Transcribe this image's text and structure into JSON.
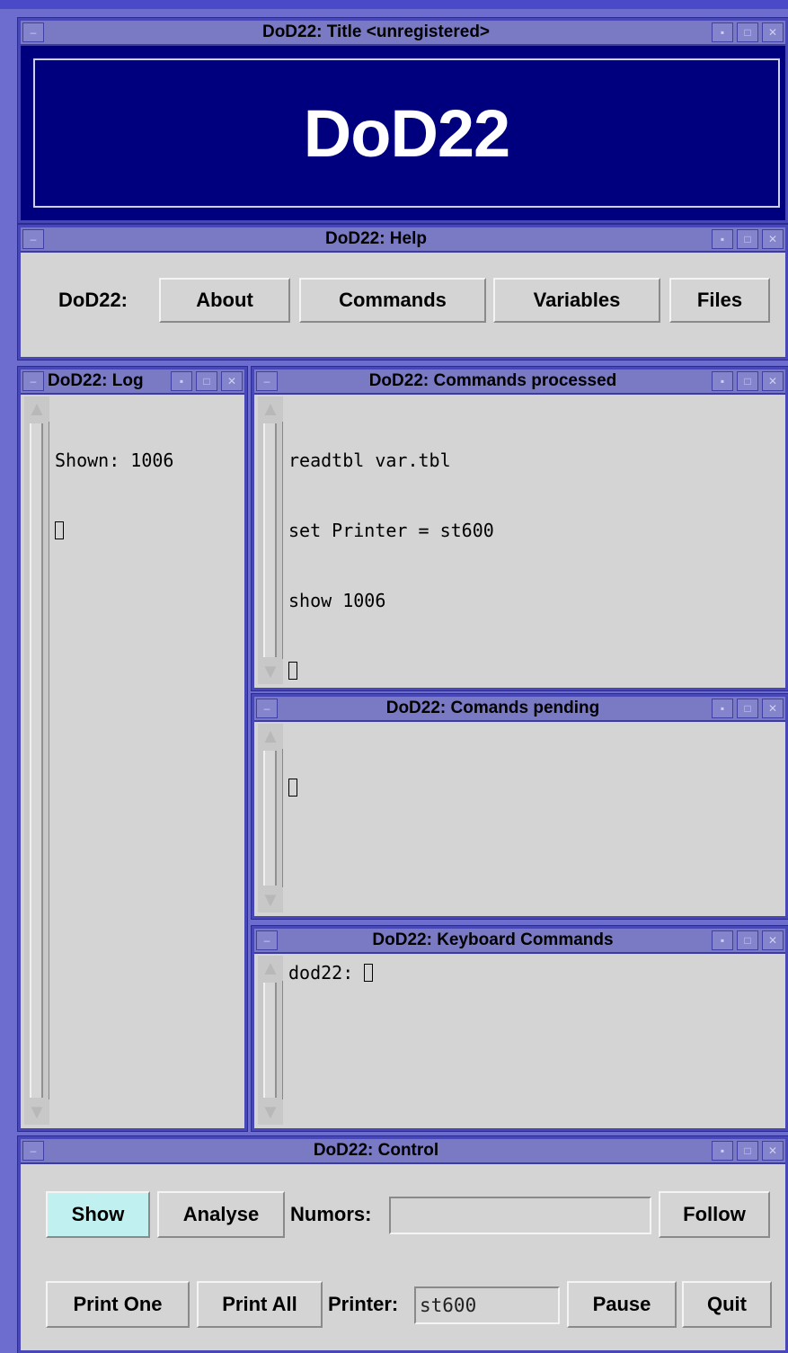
{
  "title_window": {
    "title": "DoD22: Title <unregistered>",
    "banner": "DoD22"
  },
  "help_window": {
    "title": "DoD22: Help",
    "label": "DoD22:",
    "buttons": {
      "about": "About",
      "commands": "Commands",
      "variables": "Variables",
      "files": "Files"
    }
  },
  "log_window": {
    "title": "DoD22: Log",
    "lines": [
      "Shown: 1006"
    ]
  },
  "processed_window": {
    "title": "DoD22: Commands processed",
    "lines": [
      "readtbl var.tbl",
      "set Printer = st600",
      "show 1006"
    ]
  },
  "pending_window": {
    "title": "DoD22: Comands pending"
  },
  "keyboard_window": {
    "title": "DoD22: Keyboard Commands",
    "prompt": "dod22: "
  },
  "control_window": {
    "title": "DoD22: Control",
    "buttons": {
      "show": "Show",
      "analyse": "Analyse",
      "follow": "Follow",
      "print_one": "Print One",
      "print_all": "Print All",
      "pause": "Pause",
      "quit": "Quit"
    },
    "numors_label": "Numors:",
    "numors_value": "",
    "printer_label": "Printer:",
    "printer_value": "st600"
  },
  "window_controls": {
    "menu": "‒",
    "minimize": "▪",
    "maximize": "□",
    "close": "✕"
  },
  "scroll_arrows": {
    "up": "▲",
    "down": "▼"
  },
  "colors": {
    "desktop": "#6d6dd0",
    "titlebar": "#7a7ac4",
    "banner": "#00007e",
    "show_active": "#c0f0f0"
  }
}
